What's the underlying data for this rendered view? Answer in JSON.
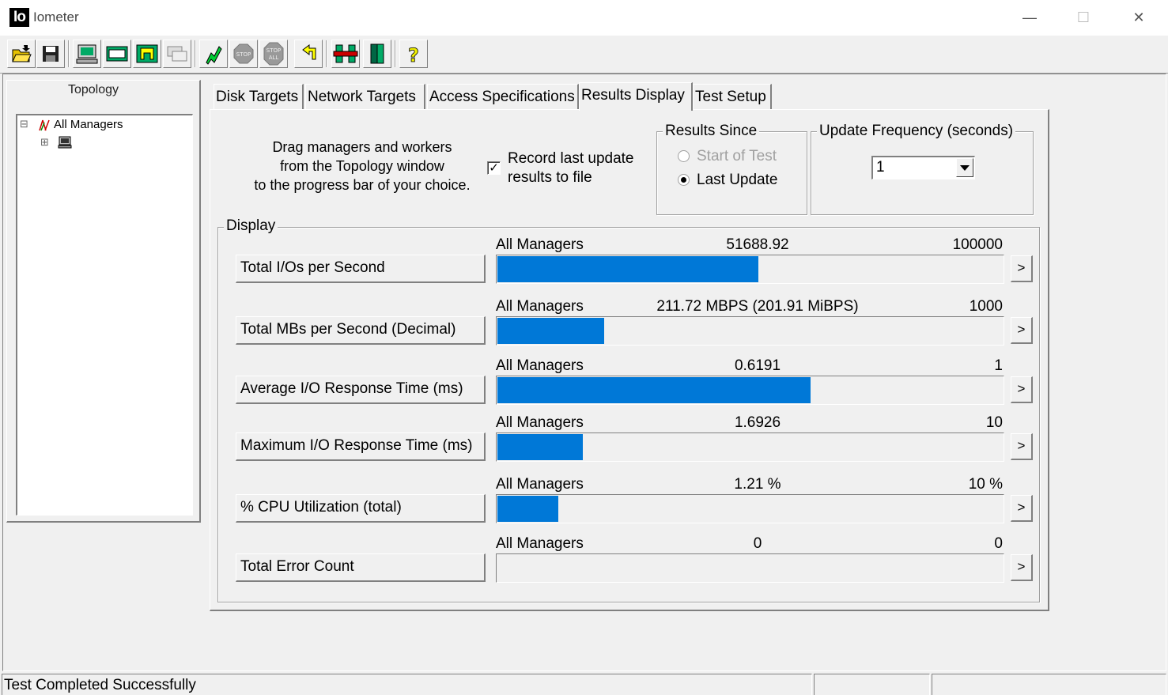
{
  "window": {
    "logo_text": "Io",
    "title": "Iometer",
    "controls": {
      "minimize": "—",
      "maximize": "☐",
      "close": "✕"
    }
  },
  "toolbar": {
    "buttons": [
      {
        "icon": "open-folder-icon"
      },
      {
        "icon": "save-disk-icon"
      },
      {
        "icon": "new-manager-icon"
      },
      {
        "icon": "new-disk-worker-icon"
      },
      {
        "icon": "new-network-worker-icon"
      },
      {
        "icon": "duplicate-worker-icon"
      },
      {
        "icon": "start-tests-icon"
      },
      {
        "icon": "stop-icon",
        "text": "STOP"
      },
      {
        "icon": "stop-all-icon",
        "text": "STOP ALL"
      },
      {
        "icon": "reset-workers-icon"
      },
      {
        "icon": "exit-icon"
      },
      {
        "icon": "quit-door-icon"
      },
      {
        "icon": "help-icon",
        "text": "?"
      }
    ]
  },
  "topology": {
    "title": "Topology",
    "tree": [
      {
        "label": "All Managers",
        "expander": "⊟",
        "icon": "all-managers-icon"
      },
      {
        "label": "",
        "expander": "⊞",
        "icon": "computer-icon"
      }
    ]
  },
  "tabs": [
    {
      "label": "Disk Targets",
      "active": false
    },
    {
      "label": "Network Targets",
      "active": false
    },
    {
      "label": "Access Specifications",
      "active": false
    },
    {
      "label": "Results Display",
      "active": true
    },
    {
      "label": "Test Setup",
      "active": false
    }
  ],
  "instructions": {
    "line1": "Drag managers and workers",
    "line2": "from the Topology window",
    "line3": "to the progress bar of your choice."
  },
  "record_option": {
    "checked": true,
    "check_mark": "✓",
    "line1": "Record last update",
    "line2": "results to file"
  },
  "results_since": {
    "title": "Results Since",
    "options": [
      {
        "label": "Start of Test",
        "selected": false,
        "enabled": false
      },
      {
        "label": "Last Update",
        "selected": true,
        "enabled": true
      }
    ]
  },
  "update_frequency": {
    "title": "Update Frequency (seconds)",
    "value": "1"
  },
  "display": {
    "title": "Display",
    "metrics": [
      {
        "label": "Total I/Os per Second",
        "source": "All Managers",
        "value": "51688.92",
        "max": "100000",
        "fill": 0.517
      },
      {
        "label": "Total MBs per Second (Decimal)",
        "source": "All Managers",
        "value": "211.72 MBPS (201.91 MiBPS)",
        "max": "1000",
        "fill": 0.212
      },
      {
        "label": "Average I/O Response Time (ms)",
        "source": "All Managers",
        "value": "0.6191",
        "max": "1",
        "fill": 0.619
      },
      {
        "label": "Maximum I/O Response Time (ms)",
        "source": "All Managers",
        "value": "1.6926",
        "max": "10",
        "fill": 0.169
      },
      {
        "label": "% CPU Utilization (total)",
        "source": "All Managers",
        "value": "1.21 %",
        "max": "10 %",
        "fill": 0.121
      },
      {
        "label": "Total Error Count",
        "source": "All Managers",
        "value": "0",
        "max": "0",
        "fill": 0
      }
    ],
    "arrow_label": ">"
  },
  "status": {
    "message": "Test Completed Successfully"
  },
  "colors": {
    "bar_fill": "#0078d7",
    "window_bg": "#f0f0f0"
  }
}
